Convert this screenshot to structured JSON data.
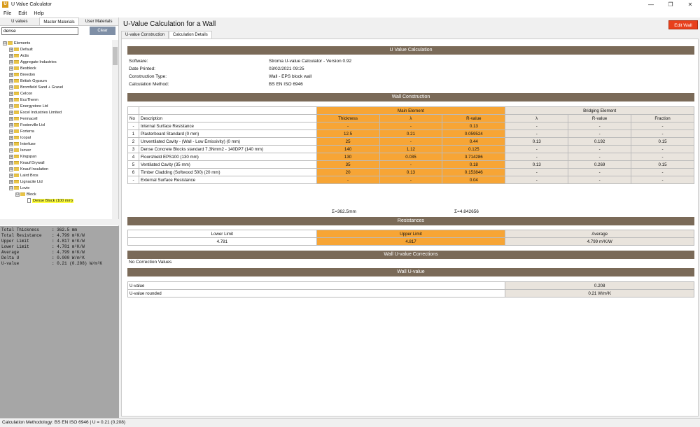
{
  "window": {
    "title": "U Value Calculator",
    "icon_letter": "U",
    "controls": [
      "—",
      "❐",
      "✕"
    ]
  },
  "menu": [
    "File",
    "Edit",
    "Help"
  ],
  "left_tabs": [
    "U values",
    "Master Materials",
    "User Materials"
  ],
  "search": {
    "value": "dense",
    "clear_label": "Clear"
  },
  "tree": [
    {
      "label": "Elements",
      "level": 0,
      "exp": "⊟",
      "kind": "folder"
    },
    {
      "label": "Default",
      "level": 1,
      "exp": "⊞",
      "kind": "folder"
    },
    {
      "label": "Actis",
      "level": 1,
      "exp": "⊞",
      "kind": "folder"
    },
    {
      "label": "Aggregate Industries",
      "level": 1,
      "exp": "⊞",
      "kind": "folder"
    },
    {
      "label": "Besblock",
      "level": 1,
      "exp": "⊞",
      "kind": "folder"
    },
    {
      "label": "Breedon",
      "level": 1,
      "exp": "⊞",
      "kind": "folder"
    },
    {
      "label": "British Gypsum",
      "level": 1,
      "exp": "⊞",
      "kind": "folder"
    },
    {
      "label": "Bromfield Sand  + Gravel",
      "level": 1,
      "exp": "⊞",
      "kind": "folder"
    },
    {
      "label": "Celcon",
      "level": 1,
      "exp": "⊞",
      "kind": "folder"
    },
    {
      "label": "EcoTherm",
      "level": 1,
      "exp": "⊞",
      "kind": "folder"
    },
    {
      "label": "Energystore Ltd",
      "level": 1,
      "exp": "⊞",
      "kind": "folder"
    },
    {
      "label": "Excel Industries Limited",
      "level": 1,
      "exp": "⊞",
      "kind": "folder"
    },
    {
      "label": "Fermacell",
      "level": 1,
      "exp": "⊞",
      "kind": "folder"
    },
    {
      "label": "Fosterville Ltd",
      "level": 1,
      "exp": "⊞",
      "kind": "folder"
    },
    {
      "label": "Forterra",
      "level": 1,
      "exp": "⊞",
      "kind": "folder"
    },
    {
      "label": "Icopal",
      "level": 1,
      "exp": "⊞",
      "kind": "folder"
    },
    {
      "label": "Interfuse",
      "level": 1,
      "exp": "⊞",
      "kind": "folder"
    },
    {
      "label": "Isover",
      "level": 1,
      "exp": "⊞",
      "kind": "folder"
    },
    {
      "label": "Kingspan",
      "level": 1,
      "exp": "⊞",
      "kind": "folder"
    },
    {
      "label": "Knauf Drywall",
      "level": 1,
      "exp": "⊞",
      "kind": "folder"
    },
    {
      "label": "Knauf Insulation",
      "level": 1,
      "exp": "⊞",
      "kind": "folder"
    },
    {
      "label": "Laird Bros",
      "level": 1,
      "exp": "⊞",
      "kind": "folder"
    },
    {
      "label": "Lignacite Ltd",
      "level": 1,
      "exp": "⊞",
      "kind": "folder"
    },
    {
      "label": "Lovie",
      "level": 1,
      "exp": "⊟",
      "kind": "folder"
    },
    {
      "label": "Block",
      "level": 2,
      "exp": "⊟",
      "kind": "folder"
    },
    {
      "label": "Dense Block  (100 mm)",
      "level": 3,
      "exp": "",
      "kind": "doc",
      "selected": true
    }
  ],
  "stats": [
    {
      "k": "Total Thickness",
      "v": "362.5 mm"
    },
    {
      "k": "Total Resistance",
      "v": "4.799 m²K/W"
    },
    {
      "k": "Upper Limit",
      "v": "4.817 m²K/W"
    },
    {
      "k": "Lower Limit",
      "v": "4.781 m²K/W"
    },
    {
      "k": "Average",
      "v": "4.799 m²K/W"
    },
    {
      "k": "Delta U",
      "v": "0.000 W/m²K"
    },
    {
      "k": "U-value",
      "v": "0.21 (0.208) W/m²K"
    }
  ],
  "status": "Calculation Methodology: BS EN ISO 6946  |  U = 0.21 (0.208)",
  "page_title": "U-Value Calculation for a Wall",
  "edit_button": "Edit Wall",
  "main_tabs": [
    "U-value Construction",
    "Calculation Details"
  ],
  "sections": {
    "calc": "U Value Calculation",
    "wall": "Wall Construction",
    "resistances": "Resistances",
    "corrections": "Wall U-value Corrections",
    "uvalue": "Wall U-value"
  },
  "info": [
    {
      "k": "Software:",
      "v": "Stroma U-value Calculator - Version 0.92"
    },
    {
      "k": "Date Printed:",
      "v": "03/02/2021 09:25"
    },
    {
      "k": "Construction Type:",
      "v": "Wall - EPS block wall"
    },
    {
      "k": "Calculation Method:",
      "v": "BS EN ISO 6946"
    }
  ],
  "wall_table": {
    "group_main": "Main Element",
    "group_bridge": "Bridging Element",
    "headers": [
      "No",
      "Description",
      "Thickness",
      "λ",
      "R-value",
      "λ",
      "R-value",
      "Fraction"
    ],
    "rows": [
      [
        "-",
        "Internal Surface Resistance",
        "-",
        "-",
        "0.13",
        "-",
        "-",
        "-"
      ],
      [
        "1",
        "Plasterboard Standard (0 mm)",
        "12.5",
        "0.21",
        "0.059524",
        "-",
        "-",
        "-"
      ],
      [
        "2",
        "Unventilated Cavity - (Wall - Low Emissivity) (0 mm)",
        "25",
        "-",
        "0.44",
        "0.13",
        "0.192",
        "0.15"
      ],
      [
        "3",
        "Dense Concrete Blocks standard 7.3Nmm2 - 140DP7 (140 mm)",
        "140",
        "1.12",
        "0.125",
        "-",
        "-",
        "-"
      ],
      [
        "4",
        "Floorshield EPS100 (130 mm)",
        "130",
        "0.035",
        "3.714286",
        "-",
        "-",
        "-"
      ],
      [
        "5",
        "Ventilated Cavity (35 mm)",
        "35",
        "-",
        "0.18",
        "0.13",
        "0.269",
        "0.15"
      ],
      [
        "6",
        "Timber Cladding (Softwood 500) (20 mm)",
        "20",
        "0.13",
        "0.153846",
        "-",
        "-",
        "-"
      ],
      [
        "-",
        "External Surface Resistance",
        "-",
        "-",
        "0.04",
        "-",
        "-",
        "-"
      ]
    ],
    "sum_thickness": "Σ=362.5mm",
    "sum_r": "Σ=4.842656"
  },
  "resistances": {
    "headers": [
      "Lower Limit",
      "Upper Limit",
      "Average"
    ],
    "values": [
      "4.781",
      "4.817",
      "4.799 m²K/W"
    ]
  },
  "corrections_text": "No Correction Values",
  "uvalue_rows": [
    {
      "k": "U-value",
      "v": "0.208"
    },
    {
      "k": "U-value rounded",
      "v": "0.21 W/m²K"
    }
  ],
  "colors": {
    "band": "#7a6a58",
    "orange": "#f7a535",
    "edit": "#e8401c",
    "highlight": "#ffff40",
    "stats_bg": "#a6a6a6"
  }
}
